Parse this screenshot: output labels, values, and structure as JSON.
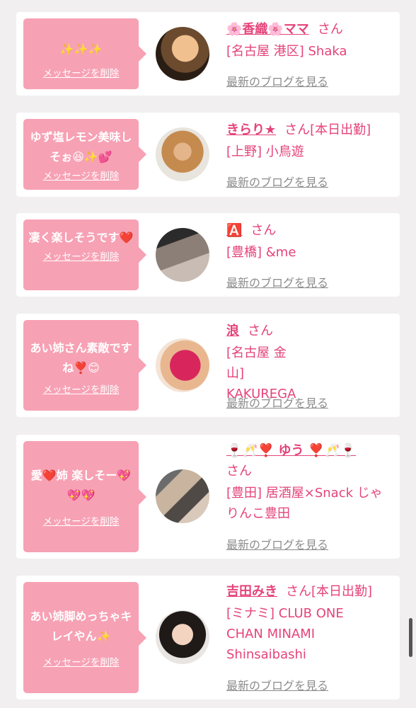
{
  "delete_label": "メッセージを削除",
  "blog_label": "最新のブログを見る",
  "honorific": "さん",
  "colors": {
    "bubble": "#f7a1b4",
    "accent": "#e5437a",
    "muted": "#8c8c8c",
    "background": "#f1eff0"
  },
  "items": [
    {
      "message": "✨✨✨",
      "name": "🌸香織🌸ママ",
      "status": "",
      "area": "[名古屋 港区] Shaka"
    },
    {
      "message": "ゆず塩レモン美味しそぉ😆✨💕",
      "name": "きらり★",
      "status": "[本日出勤]",
      "area": "[上野] 小鳥遊"
    },
    {
      "message": "凄く楽しそうです❤️",
      "name": "🅰️",
      "status": "",
      "area": "[豊橋] &me"
    },
    {
      "message": "あい姉さん素敵ですね❣️😊",
      "name": "浪",
      "status": "",
      "area": "[名古屋 金山] KAKUREGA"
    },
    {
      "message": "愛❤️姉 楽しそー💖💖💖",
      "name": "🍷🥂❣️ ゆう ❣️🥂🍷",
      "status": "",
      "area": "[豊田] 居酒屋×Snack じゃりんこ豊田"
    },
    {
      "message": "あい姉脚めっちゃキレイやん✨",
      "name": "吉田みき",
      "status": "[本日出勤]",
      "area": "[ミナミ] CLUB ONE CHAN MINAMI Shinsaibashi"
    }
  ]
}
